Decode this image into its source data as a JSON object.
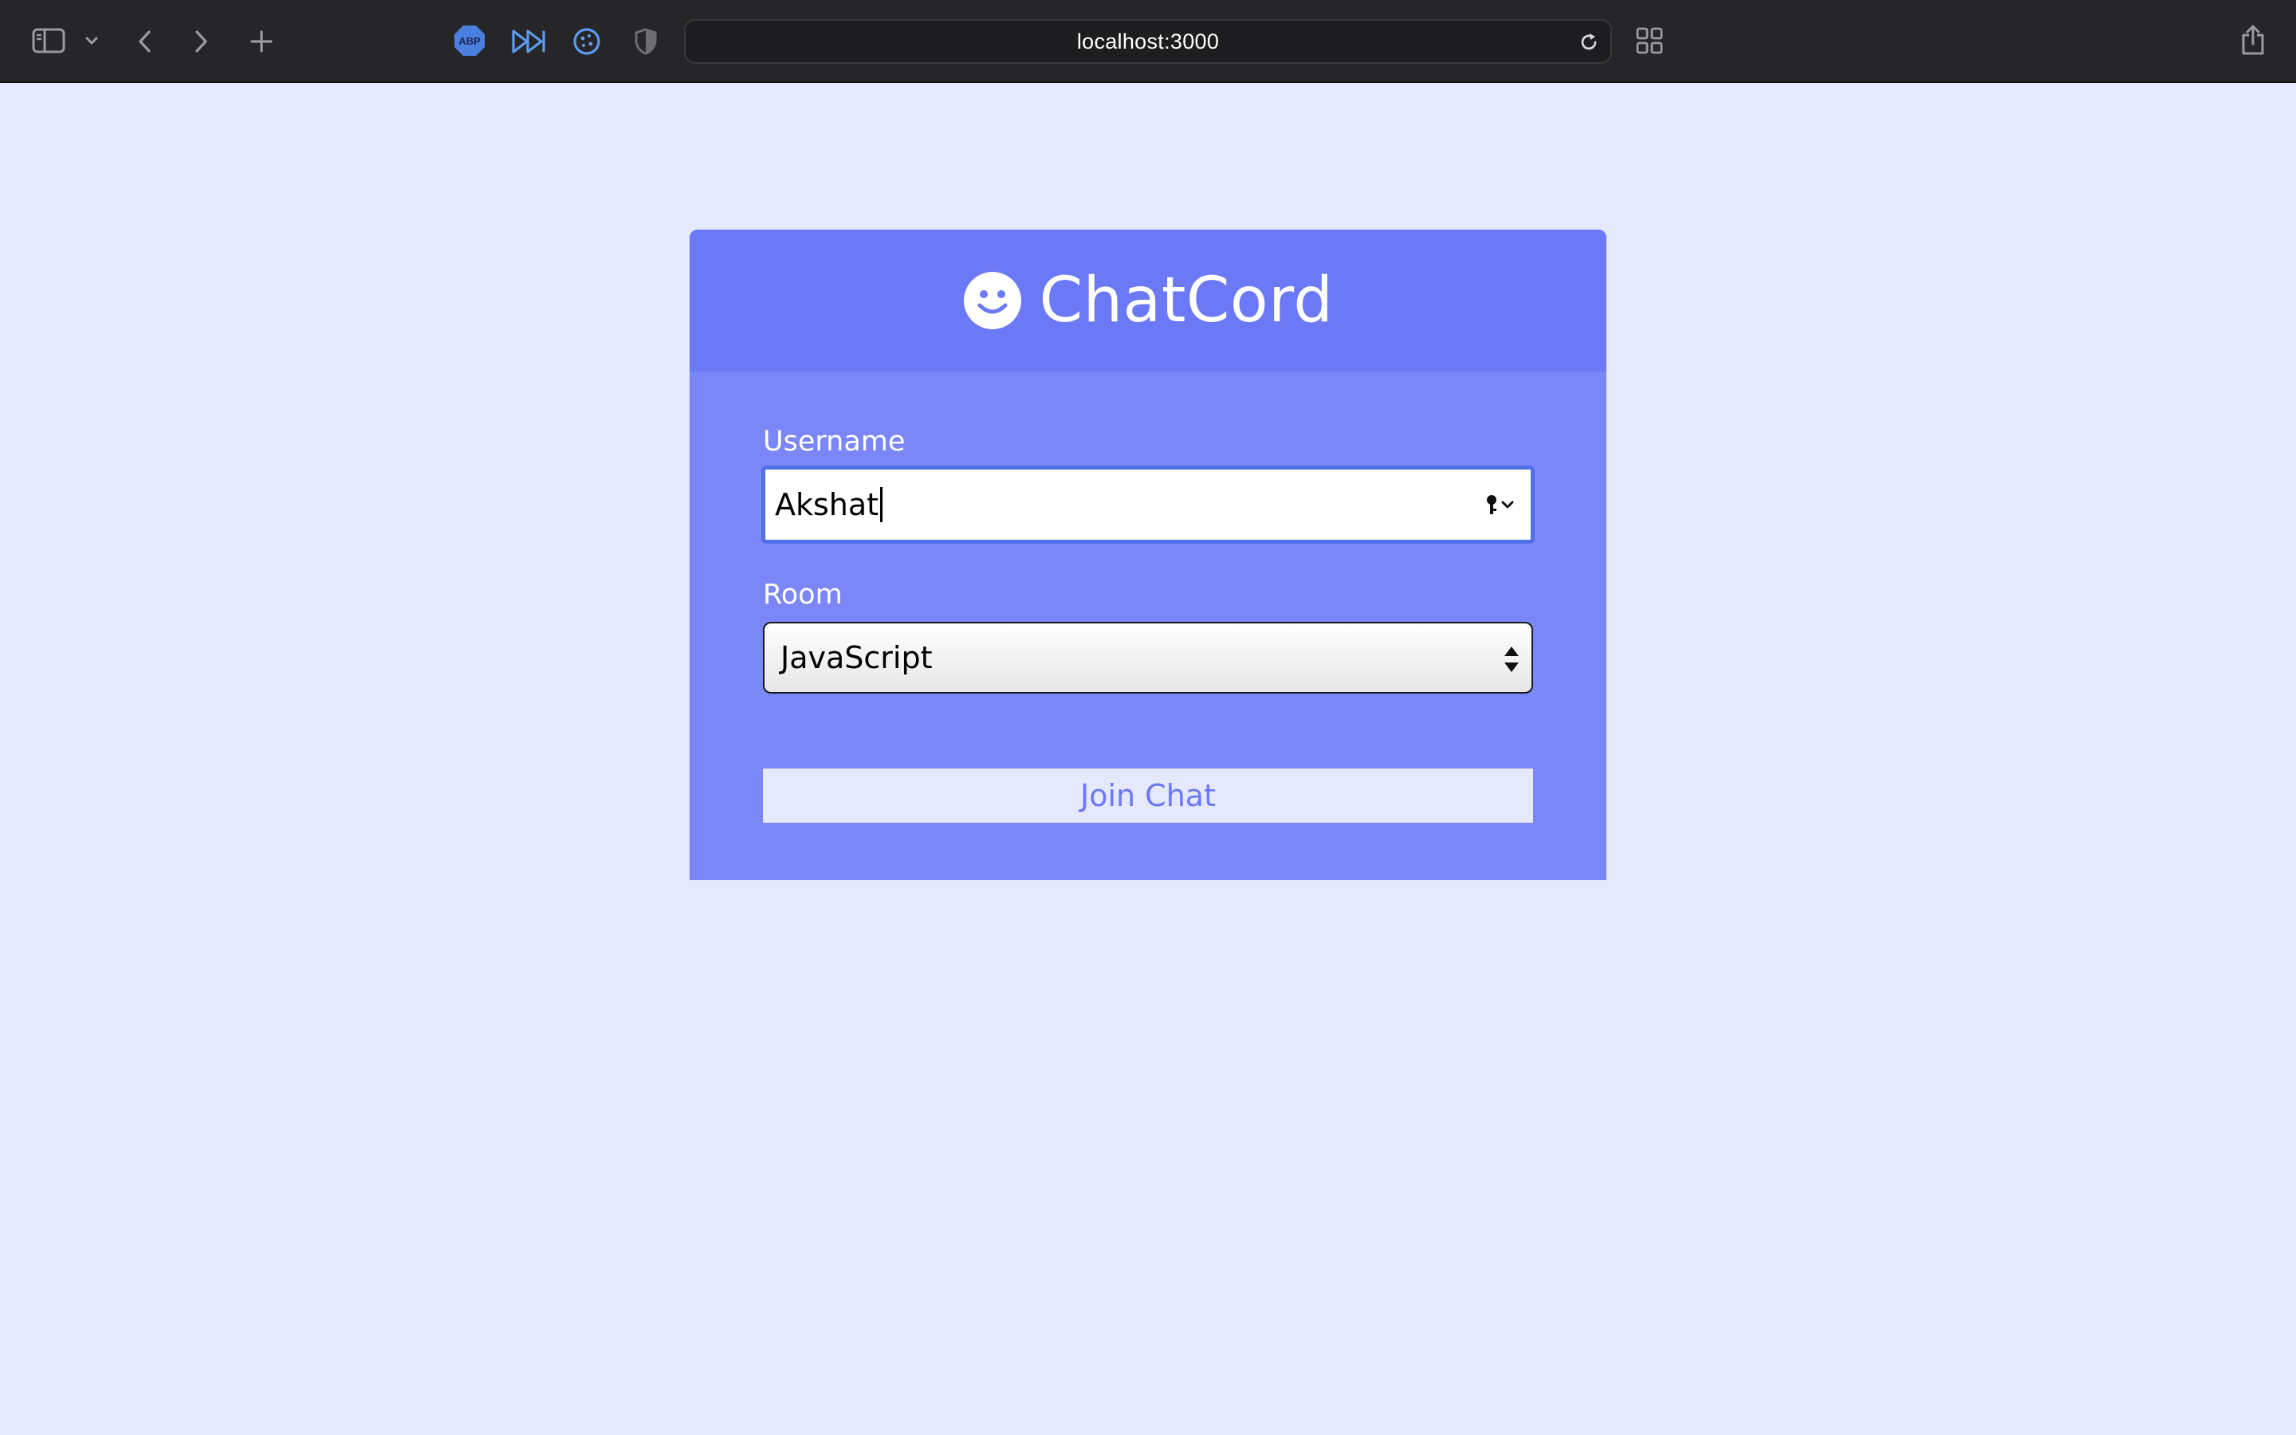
{
  "browser": {
    "url": "localhost:3000",
    "toolbar_icons": [
      "sidebar-icon",
      "chevron-down-icon",
      "back-icon",
      "forward-icon",
      "new-tab-icon",
      "abp-extension-icon",
      "fast-forward-extension-icon",
      "cookie-extension-icon",
      "shield-extension-icon",
      "reload-icon",
      "tab-overview-icon",
      "share-icon"
    ],
    "abp_badge": "ABP"
  },
  "app": {
    "title": "ChatCord",
    "icon": "smile-icon",
    "colors": {
      "page_background": "#e6e9fc",
      "header": "#6b79f6",
      "card_body": "#7b86f7",
      "input_focus": "#4f6fe8"
    }
  },
  "form": {
    "username": {
      "label": "Username",
      "value": "Akshat"
    },
    "room": {
      "label": "Room",
      "selected": "JavaScript"
    },
    "submit_label": "Join Chat"
  }
}
